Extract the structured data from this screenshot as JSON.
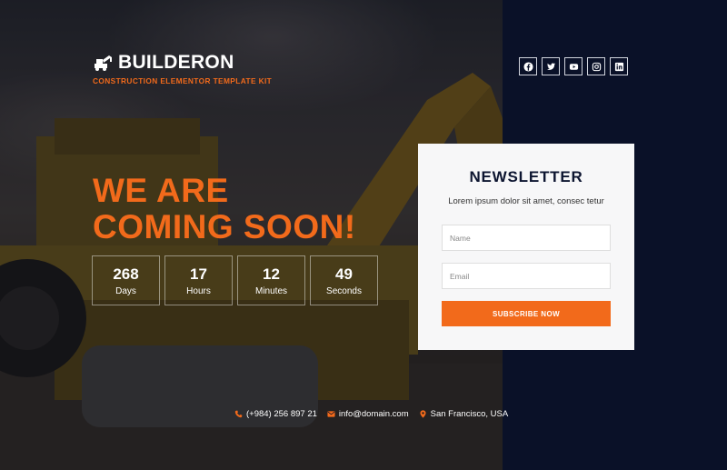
{
  "brand": {
    "name": "BUILDERON",
    "tagline": "CONSTRUCTION ELEMENTOR TEMPLATE KIT"
  },
  "headline": {
    "line1": "WE ARE",
    "line2": "COMING SOON!"
  },
  "countdown": [
    {
      "value": "268",
      "unit": "Days"
    },
    {
      "value": "17",
      "unit": "Hours"
    },
    {
      "value": "12",
      "unit": "Minutes"
    },
    {
      "value": "49",
      "unit": "Seconds"
    }
  ],
  "social": [
    "facebook-icon",
    "twitter-icon",
    "youtube-icon",
    "instagram-icon",
    "linkedin-icon"
  ],
  "newsletter": {
    "title": "NEWSLETTER",
    "subtitle": "Lorem ipsum dolor sit amet, consec tetur",
    "name_placeholder": "Name",
    "email_placeholder": "Email",
    "button": "SUBSCRIBE NOW"
  },
  "contact": {
    "phone": "(+984) 256 897 21",
    "email": "info@domain.com",
    "location": "San Francisco, USA"
  },
  "colors": {
    "accent": "#f26a1b",
    "panel": "#0a1128",
    "card": "#f7f7f8"
  }
}
